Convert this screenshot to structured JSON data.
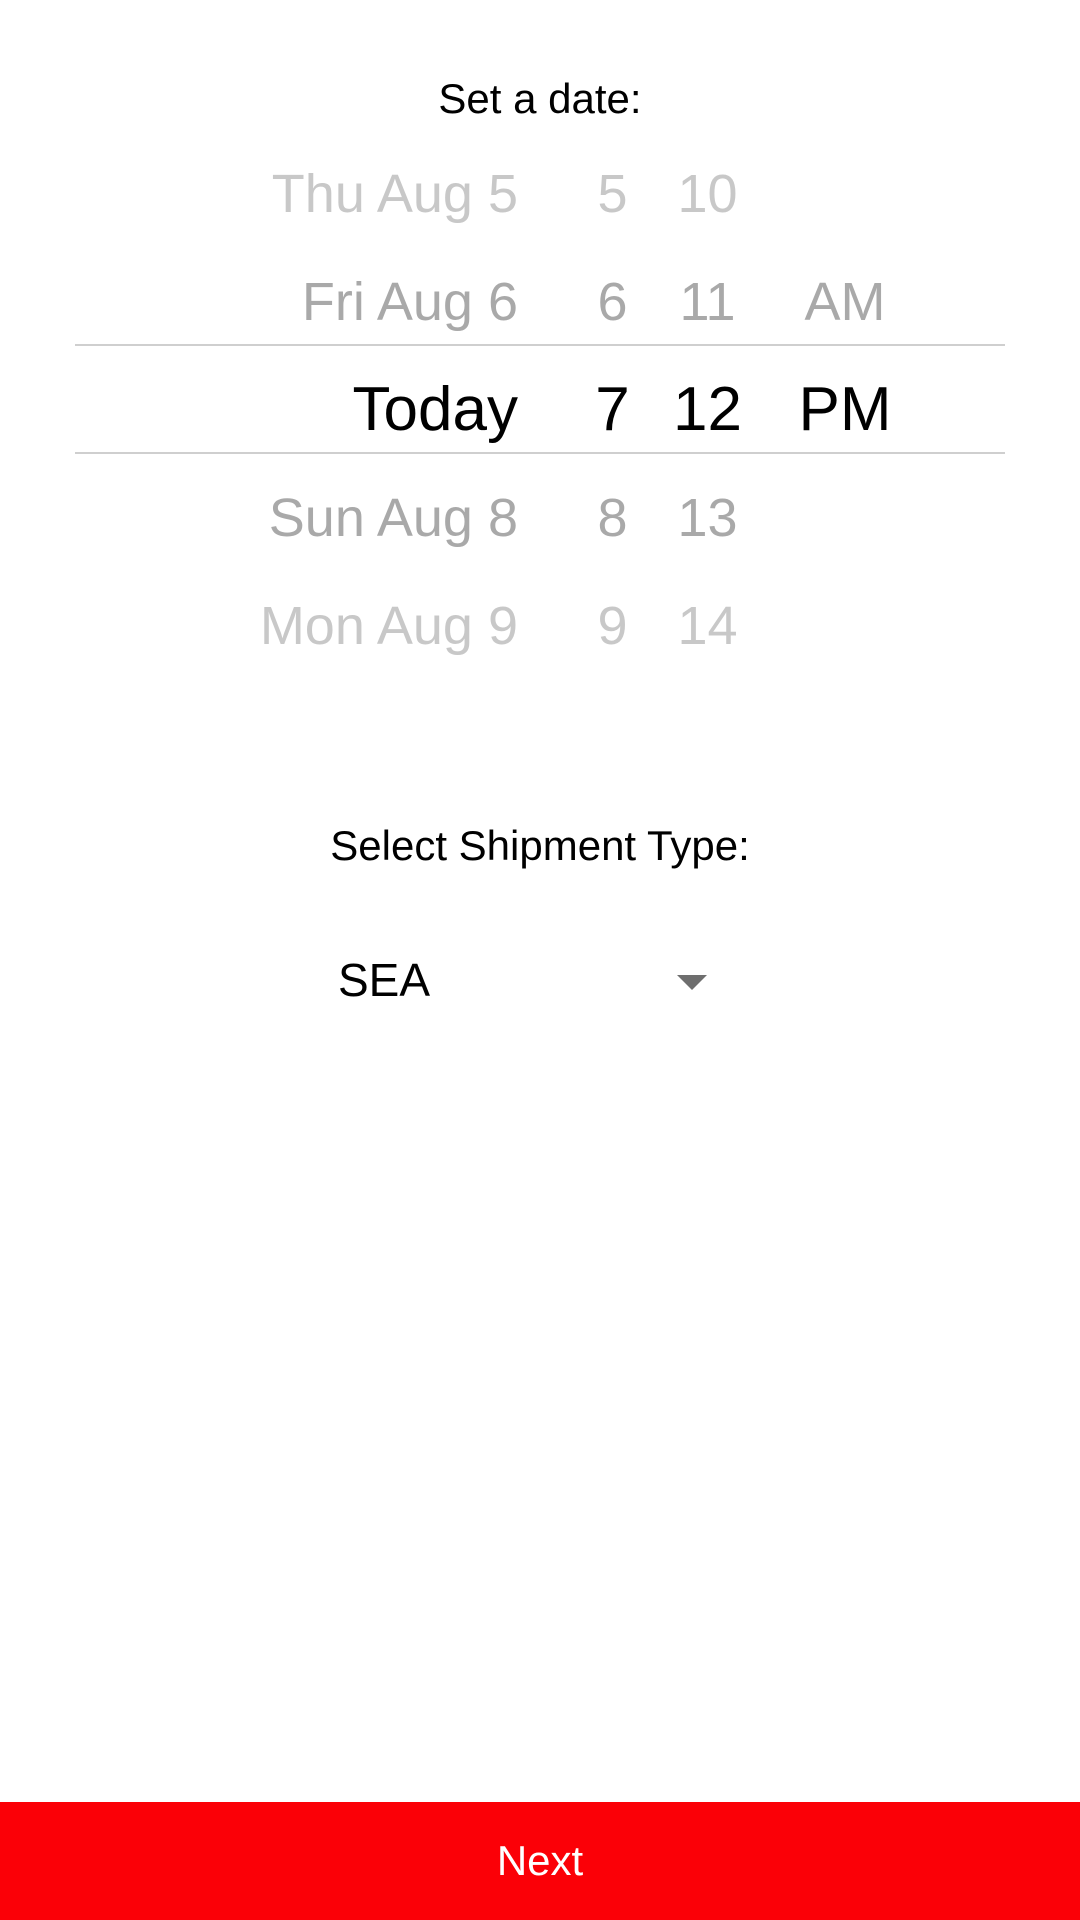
{
  "date_label": "Set a date:",
  "picker": {
    "date_column": [
      "Thu Aug 5",
      "Fri Aug 6",
      "Today",
      "Sun Aug 8",
      "Mon Aug 9"
    ],
    "hour_column": [
      "5",
      "6",
      "7",
      "8",
      "9"
    ],
    "minute_column": [
      "10",
      "11",
      "12",
      "13",
      "14"
    ],
    "ampm_column": [
      "AM",
      "PM"
    ],
    "selected": {
      "date": "Today",
      "hour": "7",
      "minute": "12",
      "ampm": "PM"
    }
  },
  "shipment_label": "Select Shipment Type:",
  "shipment_dropdown": {
    "selected_value": "SEA",
    "icon": "dropdown-arrow-icon"
  },
  "next_button": {
    "label": "Next",
    "color": "#fb0007"
  }
}
